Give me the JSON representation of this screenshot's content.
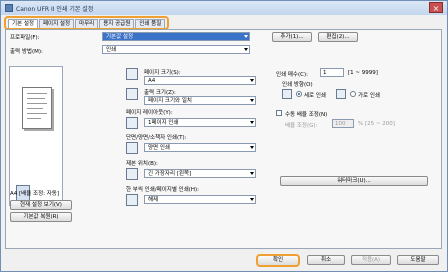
{
  "window": {
    "title": "Canon                    UFR II 인쇄 기본 설정"
  },
  "tabs": [
    "기본 설정",
    "페이지 설정",
    "마무리",
    "용지 공급원",
    "인쇄 품질"
  ],
  "profile": {
    "label": "프로파일(F):",
    "value": "기본값 설정",
    "add_btn": "추가(1)...",
    "edit_btn": "편집(2)..."
  },
  "output": {
    "label": "출력 방법(M):",
    "value": "인쇄"
  },
  "page_size": {
    "label": "페이지 크기(S):",
    "value": "A4"
  },
  "output_size": {
    "label": "출력 크기(Z):",
    "value": "페이지 크기와 일치"
  },
  "layout": {
    "label": "페이지 레이아웃(Y):",
    "value": "1페이지 인쇄"
  },
  "duplex": {
    "label": "단면/양면/소책자 인쇄(T):",
    "value": "양면 인쇄"
  },
  "binding": {
    "label": "제본 위치(B):",
    "value": "긴 가장자리 [왼쪽]"
  },
  "collate": {
    "label": "한 부씩 인쇄/페이지별 인쇄(H):",
    "value": "해제"
  },
  "copies": {
    "label": "인쇄 매수(C):",
    "value": "1",
    "range": "[1 ~ 9999]"
  },
  "orientation": {
    "label": "인쇄 방향(O)",
    "portrait": "세로 인쇄",
    "landscape": "가로 인쇄"
  },
  "manual_scale": {
    "label": "수동 배율 조정(N)",
    "sub_label": "배율 조정(G):",
    "value": "100",
    "range": "% [25 ~ 200]"
  },
  "watermark_btn": "워터마크(U)...",
  "preview": {
    "caption": "A4 [배율 조정: 자동]",
    "view_btn": "현재 설정 보기(V)",
    "restore_btn": "기본값 복원(R)"
  },
  "footer": {
    "ok": "확인",
    "cancel": "취소",
    "apply": "적용(A)",
    "help": "도움말"
  }
}
